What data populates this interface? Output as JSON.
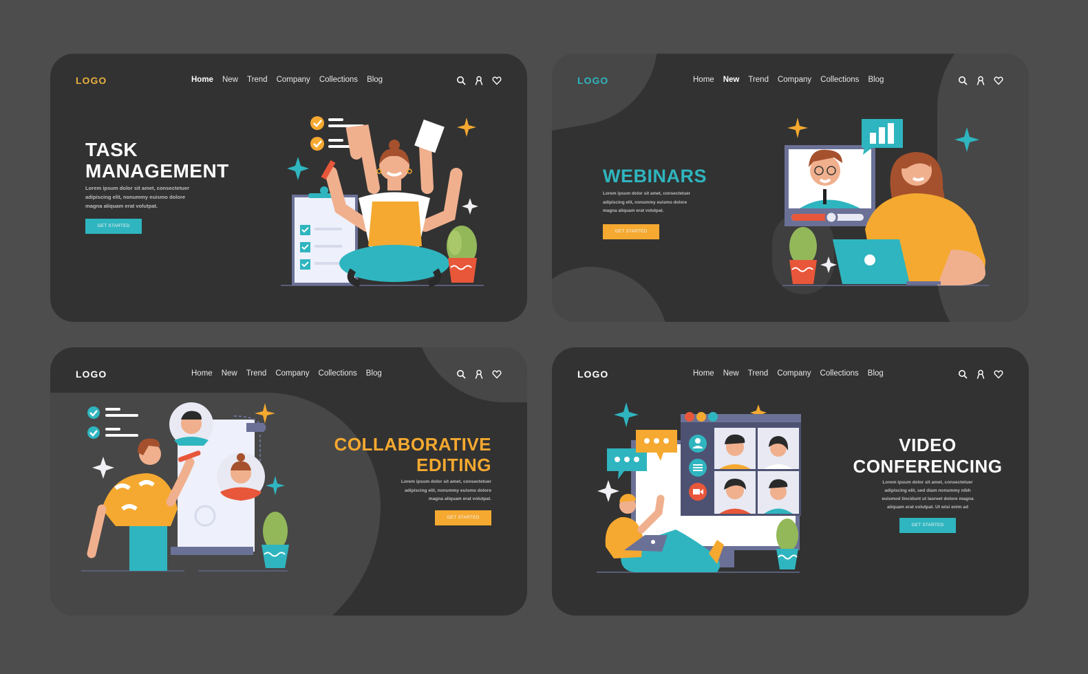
{
  "nav_menu": [
    "Home",
    "New",
    "Trend",
    "Company",
    "Collections",
    "Blog"
  ],
  "nav_icons": [
    "search-icon",
    "user-icon",
    "heart-icon"
  ],
  "colors": {
    "page_background": "#4d4d4d",
    "card_background": "#323232",
    "blob": "#474747",
    "teal": "#2fb5bf",
    "orange": "#f5a930",
    "white": "#ffffff"
  },
  "cards": [
    {
      "logo": "LOGO",
      "logo_color": "#e9b040",
      "active_nav": "Home",
      "title_lines": [
        "TASK",
        "MANAGEMENT"
      ],
      "title_color": "#ffffff",
      "body_lines": [
        "Lorem ipsum dolor sit amet, consectetuer",
        "adipiscing elit, nonummy euismo dolore",
        "magna aliquam erat volutpat."
      ],
      "cta_label": "GET STARTED",
      "cta_color": "#2fb5bf",
      "align": "left"
    },
    {
      "logo": "LOGO",
      "logo_color": "#2fb5bf",
      "active_nav": "New",
      "title_lines": [
        "WEBINARS"
      ],
      "title_color": "#2fb5bf",
      "body_lines": [
        "Lorem ipsum dolor sit amet, consectetuer",
        "adipiscing elit, nonummy euismo dolore",
        "magna aliquam erat volutpat."
      ],
      "cta_label": "GET STARTED",
      "cta_color": "#f5a930",
      "align": "left"
    },
    {
      "logo": "LOGO",
      "logo_color": "#ffffff",
      "active_nav": "",
      "title_lines": [
        "COLLABORATIVE",
        "EDITING"
      ],
      "title_color": "#f5a930",
      "body_lines": [
        "Lorem ipsum dolor sit amet, consectetuer",
        "adipiscing elit, nonummy euismo dolore",
        "magna aliquam erat volutpat."
      ],
      "cta_label": "GET STARTED",
      "cta_color": "#f5a930",
      "align": "right"
    },
    {
      "logo": "LOGO",
      "logo_color": "#ffffff",
      "active_nav": "",
      "title_lines": [
        "VIDEO",
        "CONFERENCING"
      ],
      "title_color": "#ffffff",
      "body_lines": [
        "Lorem ipsum dolor sit amet, consectetuer",
        "adipiscing elit, sed diam nonummy nibh",
        "euismod tincidunt ut laoreet dolore magna",
        "aliquam erat volutpat. Ut wisi enim ad"
      ],
      "cta_label": "GET STARTED",
      "cta_color": "#2fb5bf",
      "align": "center"
    }
  ]
}
